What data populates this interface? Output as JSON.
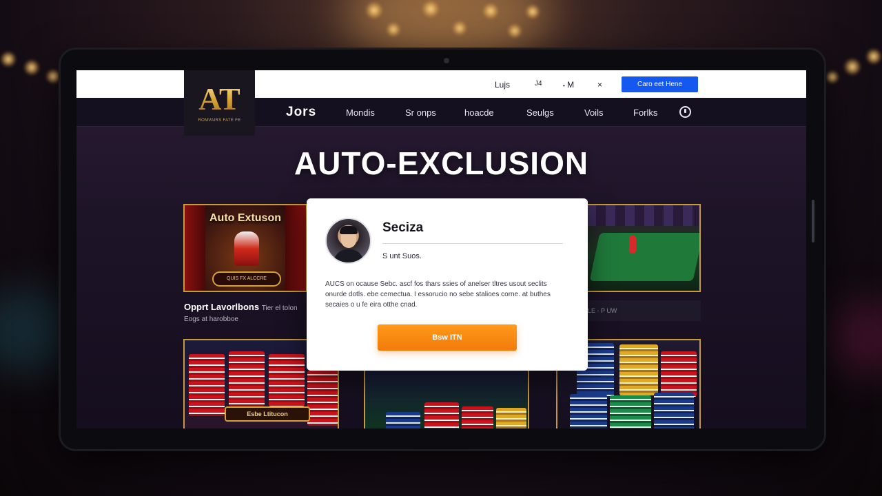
{
  "topbar": {
    "links": [
      "Lujs",
      "J4",
      "M",
      "×"
    ],
    "cta_label": "Caro eet Hene"
  },
  "logo": {
    "mark": "AT",
    "tagline": "ROMVAIRS FATE FE"
  },
  "nav": {
    "brand": "Jors",
    "items": [
      "Mondis",
      "Sr onps",
      "hoacde",
      "Seulgs",
      "Voils",
      "Forlks"
    ],
    "icon": "alert-circle-icon"
  },
  "page": {
    "title": "AUTO-EXCLUSION"
  },
  "cards": {
    "card1": {
      "title": "Auto Extuson",
      "sign": "QUIS FX ALCCRE",
      "label": "Opprt Lavorlbons",
      "label_extra": "Tier el tolon",
      "sublabel": "Eogs at harobboe"
    },
    "card3": {
      "label": "LE - P UW"
    },
    "card4": {
      "sign": "Esbe Ltitucon"
    }
  },
  "modal": {
    "title": "Seciza",
    "subtitle": "S unt Suos.",
    "body": "AUCS on ocause Sebc. ascf fos thars ssies of anelser tltres usout seclits onurde dotls. ebe cemectua. I essorucio no sebe stalioes corne. at buthes secaies o u fe eira otthe cnad.",
    "cta_label": "Bsw ITN"
  },
  "colors": {
    "accent_cta": "#1458f0",
    "modal_cta": "#f27a0a",
    "gold": "#c79a3c"
  }
}
